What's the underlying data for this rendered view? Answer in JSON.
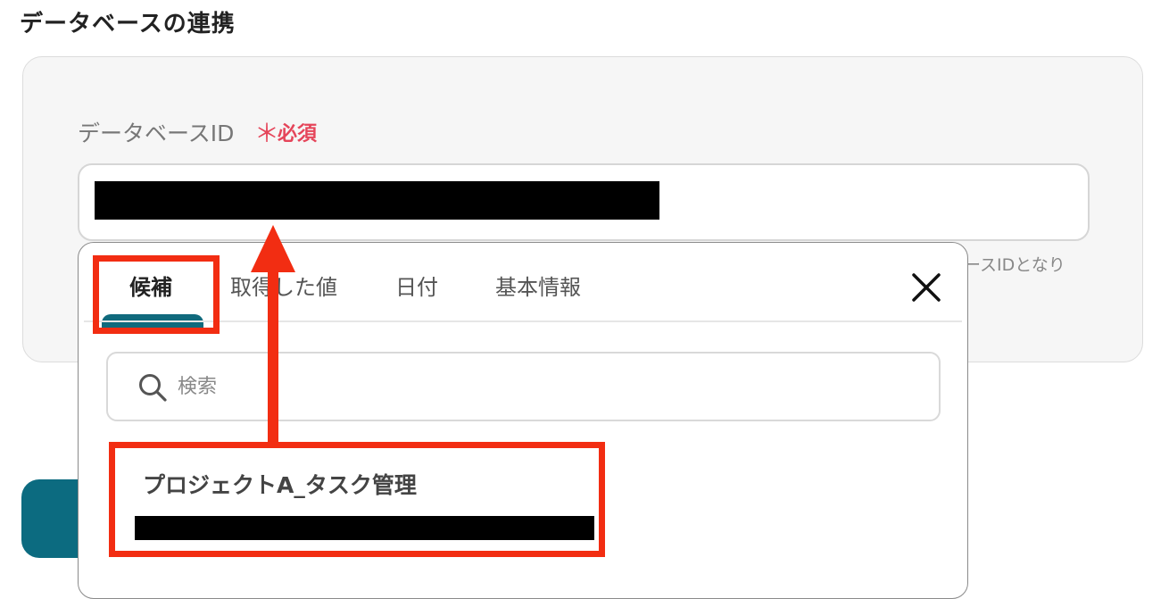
{
  "section": {
    "title": "データベースの連携"
  },
  "field": {
    "label": "データベースID",
    "required_mark": "＊",
    "required_text": "必須",
    "value_redacted": "",
    "helper_text_visible": "ースIDとなり"
  },
  "popup": {
    "tabs": [
      {
        "label": "候補",
        "active": true
      },
      {
        "label": "取得した値",
        "active": false
      },
      {
        "label": "日付",
        "active": false
      },
      {
        "label": "基本情報",
        "active": false
      }
    ],
    "close_icon": "close-icon",
    "search": {
      "placeholder": "検索",
      "icon": "search-icon"
    },
    "options": [
      {
        "title": "プロジェクトA_タスク管理",
        "subtitle_redacted": ""
      }
    ]
  },
  "colors": {
    "accent_teal": "#0c6b80",
    "required_red": "#e5455a",
    "annotation_red": "#f22d12"
  }
}
